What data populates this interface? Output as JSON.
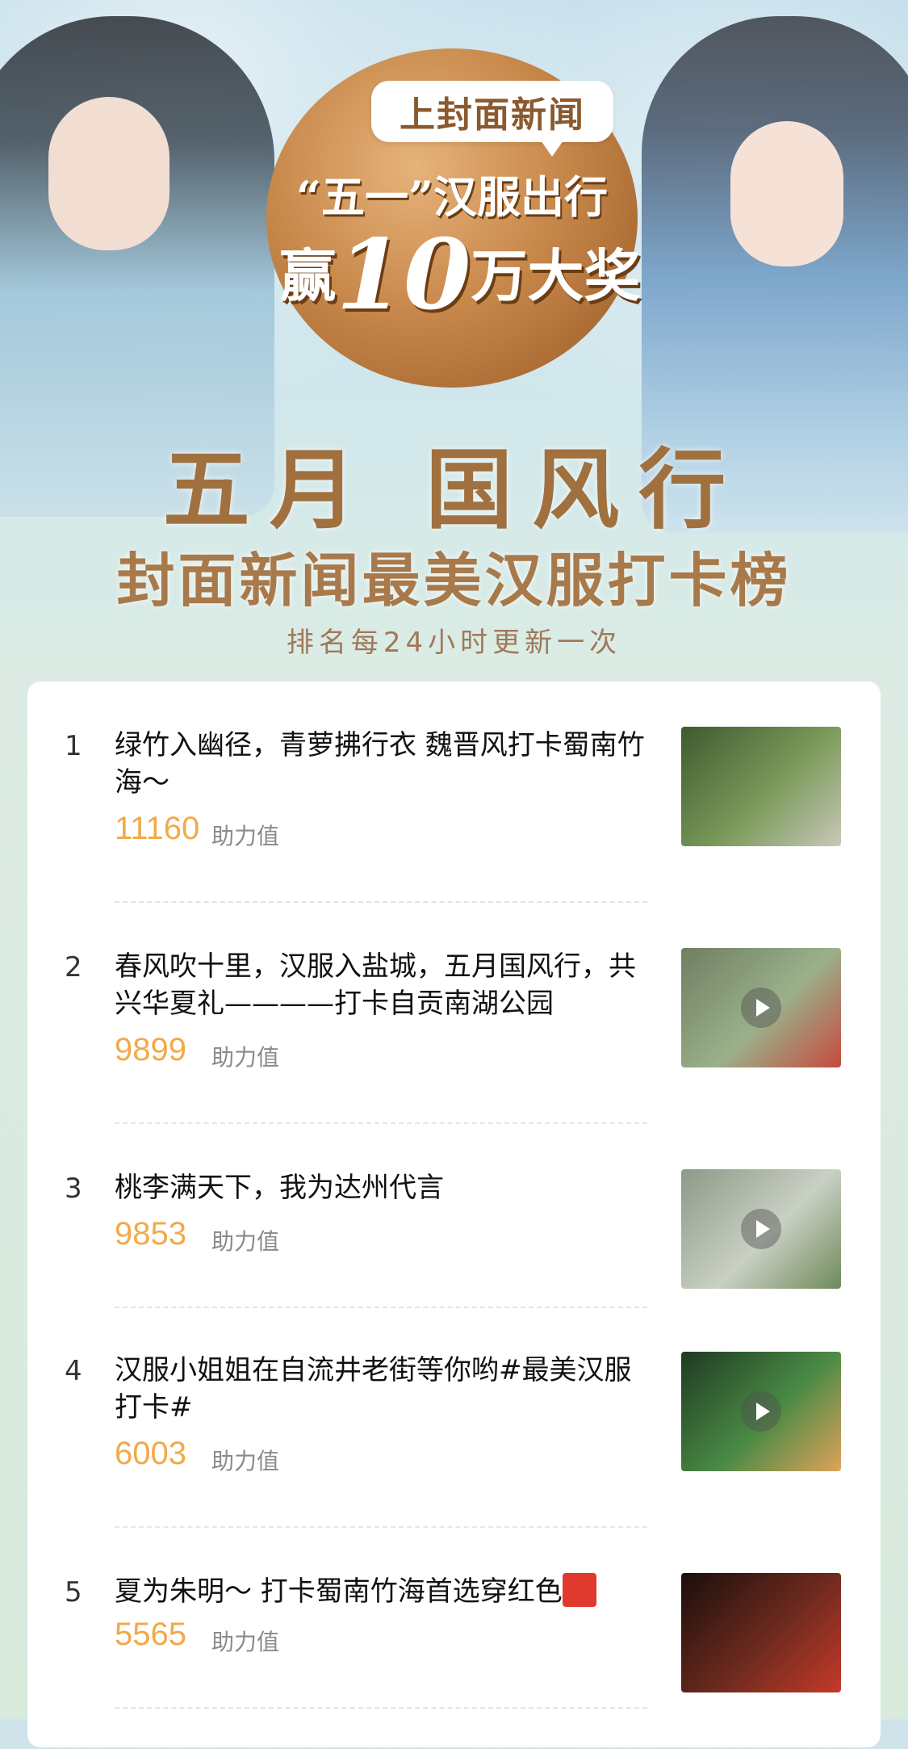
{
  "banner": {
    "bubble_text": "上封面新闻",
    "slogan_line1": "“五一”汉服出行",
    "slogan_prefix": "赢",
    "slogan_number": "10",
    "slogan_suffix": "万大奖",
    "title_main": "五月 国风行",
    "title_sub": "封面新闻最美汉服打卡榜",
    "update_note": "排名每24小时更新一次"
  },
  "score_label": "助力值",
  "entries": [
    {
      "rank": "1",
      "title": "绿竹入幽径，青萝拂行衣 魏晋风打卡蜀南竹海～",
      "score": "11160",
      "has_video": false,
      "thumb_colors": [
        "#3f5a2f",
        "#7a9a5a",
        "#c9c8b8"
      ]
    },
    {
      "rank": "2",
      "title": "春风吹十里，汉服入盐城，五月国风行，共兴华夏礼————打卡自贡南湖公园",
      "score": "9899",
      "has_video": true,
      "thumb_colors": [
        "#6f7f62",
        "#9ab08a",
        "#c74a3f"
      ]
    },
    {
      "rank": "3",
      "title": "桃李满天下，我为达州代言",
      "score": "9853",
      "has_video": true,
      "thumb_colors": [
        "#8c9a86",
        "#c9d0c4",
        "#6f8a5a"
      ]
    },
    {
      "rank": "4",
      "title": "汉服小姐姐在自流井老街等你哟#最美汉服打卡#",
      "score": "6003",
      "has_video": true,
      "thumb_colors": [
        "#1f3a22",
        "#4a8a45",
        "#e0a25a"
      ]
    },
    {
      "rank": "5",
      "title": "夏为朱明～ 打卡蜀南竹海首选穿红色",
      "score": "5565",
      "has_video": false,
      "thumb_colors": [
        "#1a0f0c",
        "#6e2a1e",
        "#c43a2a"
      ]
    }
  ]
}
